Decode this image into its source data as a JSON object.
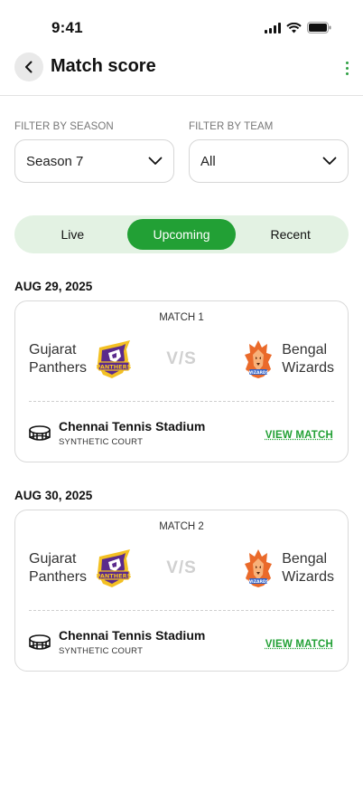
{
  "status_bar": {
    "time": "9:41"
  },
  "header": {
    "title": "Match score"
  },
  "filters": {
    "season": {
      "label": "FILTER BY SEASON",
      "value": "Season 7"
    },
    "team": {
      "label": "FILTER BY TEAM",
      "value": "All"
    }
  },
  "tabs": [
    {
      "label": "Live",
      "active": false
    },
    {
      "label": "Upcoming",
      "active": true
    },
    {
      "label": "Recent",
      "active": false
    }
  ],
  "matches": [
    {
      "date": "AUG 29, 2025",
      "label": "MATCH 1",
      "team_a": {
        "line1": "Gujarat",
        "line2": "Panthers",
        "logo": "panthers-logo"
      },
      "vs": "V/S",
      "team_b": {
        "line1": "Bengal",
        "line2": "Wizards",
        "logo": "wizards-logo"
      },
      "venue": "Chennai Tennis Stadium",
      "court": "SYNTHETIC COURT",
      "action": "VIEW MATCH"
    },
    {
      "date": "AUG 30, 2025",
      "label": "MATCH 2",
      "team_a": {
        "line1": "Gujarat",
        "line2": "Panthers",
        "logo": "panthers-logo"
      },
      "vs": "V/S",
      "team_b": {
        "line1": "Bengal",
        "line2": "Wizards",
        "logo": "wizards-logo"
      },
      "venue": "Chennai Tennis Stadium",
      "court": "SYNTHETIC COURT",
      "action": "VIEW MATCH"
    }
  ],
  "colors": {
    "accent": "#22a035",
    "tab_track": "#e3f2e3",
    "vs_text": "#d0d0d0",
    "panthers_purple": "#5b2a8c",
    "panthers_gold": "#f3c023",
    "wizards_orange": "#ea6a2a"
  }
}
